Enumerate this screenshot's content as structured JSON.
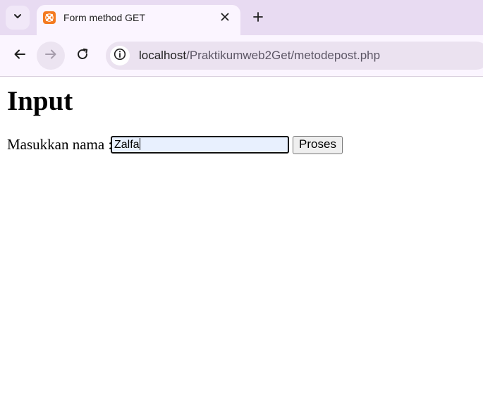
{
  "browser": {
    "tab": {
      "title": "Form method GET",
      "favicon": "xampp-icon",
      "favicon_color": "#f47a20"
    },
    "toolbar": {
      "back_icon": "arrow-left-icon",
      "forward_icon": "arrow-right-icon",
      "reload_icon": "reload-icon",
      "site_info_icon": "info-icon"
    },
    "address_bar": {
      "host": "localhost",
      "path": "/Praktikumweb2Get/metodepost.php"
    },
    "colors": {
      "tabstrip": "#e8dbf2",
      "toolbar": "#fbf5ff",
      "omnibox": "#ebe2f0"
    }
  },
  "page": {
    "heading": "Input",
    "form": {
      "name_label": "Masukkan nama :",
      "name_value": "Zalfa",
      "submit_label": "Proses",
      "input_background": "#e8f0fe"
    }
  }
}
